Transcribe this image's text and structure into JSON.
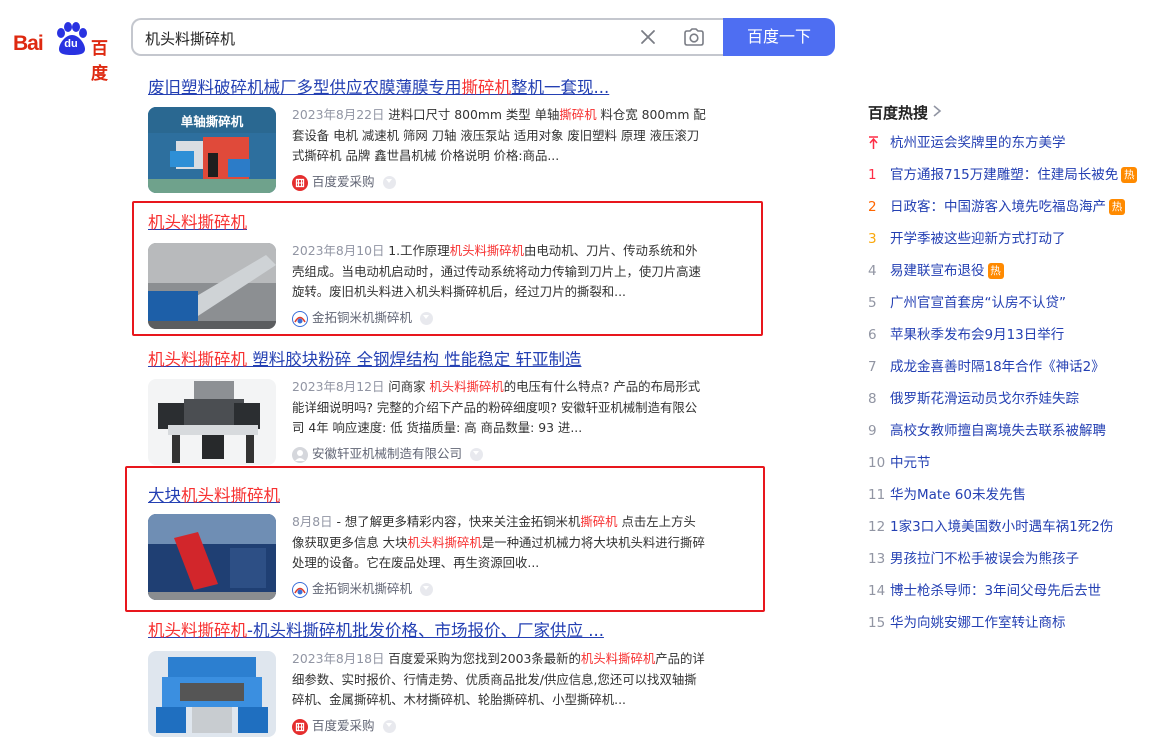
{
  "logo": {
    "latin": "Bai",
    "du": "du",
    "chinese": "百度"
  },
  "search": {
    "query": "机头料撕碎机",
    "button_label": "百度一下"
  },
  "results": [
    {
      "title_segments": [
        {
          "t": "废旧塑料破碎机械厂多型供应农膜薄膜专用",
          "em": false
        },
        {
          "t": "撕碎机",
          "em": true
        },
        {
          "t": "整机一套现...",
          "em": false
        }
      ],
      "thumb_label": "单轴撕碎机",
      "date": "2023年8月22日",
      "body_segments": [
        {
          "t": " 进料口尺寸 800mm 类型 单轴",
          "em": false
        },
        {
          "t": "撕碎机",
          "em": true
        },
        {
          "t": " 料仓宽 800mm 配套设备 电机 减速机 筛网 刀轴 液压泵站 适用对象 废旧塑料 原理 液压滚刀式撕碎机 品牌 鑫世昌机械 价格说明 价格:商品...",
          "em": false
        }
      ],
      "source": "百度爱采购"
    },
    {
      "title_segments": [
        {
          "t": "机头料撕碎机",
          "em": true
        }
      ],
      "date": "2023年8月10日",
      "body_segments": [
        {
          "t": " 1.工作原理",
          "em": false
        },
        {
          "t": "机头料撕碎机",
          "em": true
        },
        {
          "t": "由电动机、刀片、传动系统和外壳组成。当电动机启动时，通过传动系统将动力传输到刀片上，使刀片高速旋转。废旧机头料进入机头料撕碎机后，经过刀片的撕裂和...",
          "em": false
        }
      ],
      "source": "金拓铜米机撕碎机"
    },
    {
      "title_segments": [
        {
          "t": "机头料撕碎机",
          "em": true
        },
        {
          "t": " 塑料胶块粉碎 全钢焊结构 性能稳定 轩亚制造",
          "em": false
        }
      ],
      "date": "2023年8月12日",
      "body_segments": [
        {
          "t": " 问商家 ",
          "em": false
        },
        {
          "t": "机头料撕碎机",
          "em": true
        },
        {
          "t": "的电压有什么特点? 产品的布局形式能详细说明吗? 完整的介绍下产品的粉碎细度呗? 安徽轩亚机械制造有限公司 4年 响应速度: 低 货描质量: 高 商品数量: 93 进...",
          "em": false
        }
      ],
      "source": "安徽轩亚机械制造有限公司"
    },
    {
      "title_segments": [
        {
          "t": "大块",
          "em": false
        },
        {
          "t": "机头料撕碎机",
          "em": true
        }
      ],
      "date": "8月8日",
      "body_segments": [
        {
          "t": " - 想了解更多精彩内容，快来关注金拓铜米机",
          "em": false
        },
        {
          "t": "撕碎机",
          "em": true
        },
        {
          "t": " 点击左上方头像获取更多信息 大块",
          "em": false
        },
        {
          "t": "机头料撕碎机",
          "em": true
        },
        {
          "t": "是一种通过机械力将大块机头料进行撕碎处理的设备。它在废品处理、再生资源回收...",
          "em": false
        }
      ],
      "source": "金拓铜米机撕碎机"
    },
    {
      "title_segments": [
        {
          "t": "机头料撕碎机",
          "em": true
        },
        {
          "t": "-机头料撕碎机批发价格、市场报价、厂家供应 ...",
          "em": false
        }
      ],
      "date": "2023年8月18日",
      "body_segments": [
        {
          "t": " 百度爱采购为您找到2003条最新的",
          "em": false
        },
        {
          "t": "机头料撕碎机",
          "em": true
        },
        {
          "t": "产品的详细参数、实时报价、行情走势、优质商品批发/供应信息,您还可以找双轴撕碎机、金属撕碎机、木材撕碎机、轮胎撕碎机、小型撕碎机...",
          "em": false
        }
      ],
      "source": "百度爱采购"
    }
  ],
  "hot": {
    "title": "百度热搜",
    "badge_label": "热",
    "items": [
      {
        "rank": "",
        "text": "杭州亚运会奖牌里的东方美学",
        "badge": false
      },
      {
        "rank": "1",
        "text": "官方通报715万建雕塑：住建局长被免",
        "badge": true
      },
      {
        "rank": "2",
        "text": "日政客：中国游客入境先吃福岛海产",
        "badge": true
      },
      {
        "rank": "3",
        "text": "开学季被这些迎新方式打动了",
        "badge": false
      },
      {
        "rank": "4",
        "text": "易建联宣布退役",
        "badge": true
      },
      {
        "rank": "5",
        "text": "广州官宣首套房“认房不认贷”",
        "badge": false
      },
      {
        "rank": "6",
        "text": "苹果秋季发布会9月13日举行",
        "badge": false
      },
      {
        "rank": "7",
        "text": "成龙金喜善时隔18年合作《神话2》",
        "badge": false
      },
      {
        "rank": "8",
        "text": "俄罗斯花滑运动员戈尔乔娃失踪",
        "badge": false
      },
      {
        "rank": "9",
        "text": "高校女教师擅自离境失去联系被解聘",
        "badge": false
      },
      {
        "rank": "10",
        "text": "中元节",
        "badge": false
      },
      {
        "rank": "11",
        "text": "华为Mate 60未发先售",
        "badge": false
      },
      {
        "rank": "12",
        "text": "1家3口入境美国数小时遇车祸1死2伤",
        "badge": false
      },
      {
        "rank": "13",
        "text": "男孩拉门不松手被误会为熊孩子",
        "badge": false
      },
      {
        "rank": "14",
        "text": "博士枪杀导师：3年间父母先后去世",
        "badge": false
      },
      {
        "rank": "15",
        "text": "华为向姚安娜工作室转让商标",
        "badge": false
      }
    ]
  }
}
